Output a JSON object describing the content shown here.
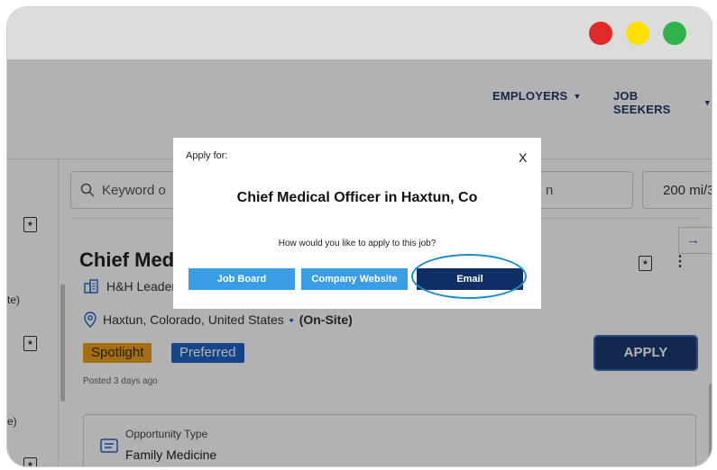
{
  "window": {
    "dot_colors": [
      "#e02a2a",
      "#ffe000",
      "#30b34a"
    ]
  },
  "nav": {
    "employers_label": "EMPLOYERS",
    "jobseekers_label": "JOB SEEKERS",
    "caret": "▼"
  },
  "search": {
    "keyword_placeholder": "Keyword o",
    "location_fragment": "n",
    "radius_value": "200 mi/3"
  },
  "side_list": {
    "items": [
      {
        "suffix": "te)"
      },
      {
        "suffix": "e)"
      }
    ]
  },
  "job": {
    "title": "Chief Med",
    "company": "H&H Leaders",
    "location": "Haxtun, Colorado, United States",
    "work_type": "(On-Site)",
    "tags": [
      {
        "label": "Spotlight",
        "bg": "#e8a020",
        "color": "#3b2a00"
      },
      {
        "label": "Preferred",
        "bg": "#1f64c4",
        "color": "#ffffff"
      }
    ],
    "posted": "Posted 3 days ago",
    "apply_label": "APPLY",
    "opportunity_type_label": "Opportunity Type",
    "opportunity_type_value": "Family Medicine"
  },
  "modal": {
    "apply_for": "Apply for:",
    "close": "X",
    "title": "Chief Medical Officer in Haxtun, Co",
    "question": "How would you like to apply to this job?",
    "buttons": [
      {
        "label": "Job Board",
        "bg": "#3a9ee6"
      },
      {
        "label": "Company Website",
        "bg": "#3a9ee6"
      },
      {
        "label": "Email",
        "bg": "#0f2f66"
      }
    ]
  },
  "colors": {
    "brand_navy": "#1b3a70",
    "highlight_ring": "#1a8cd0"
  }
}
